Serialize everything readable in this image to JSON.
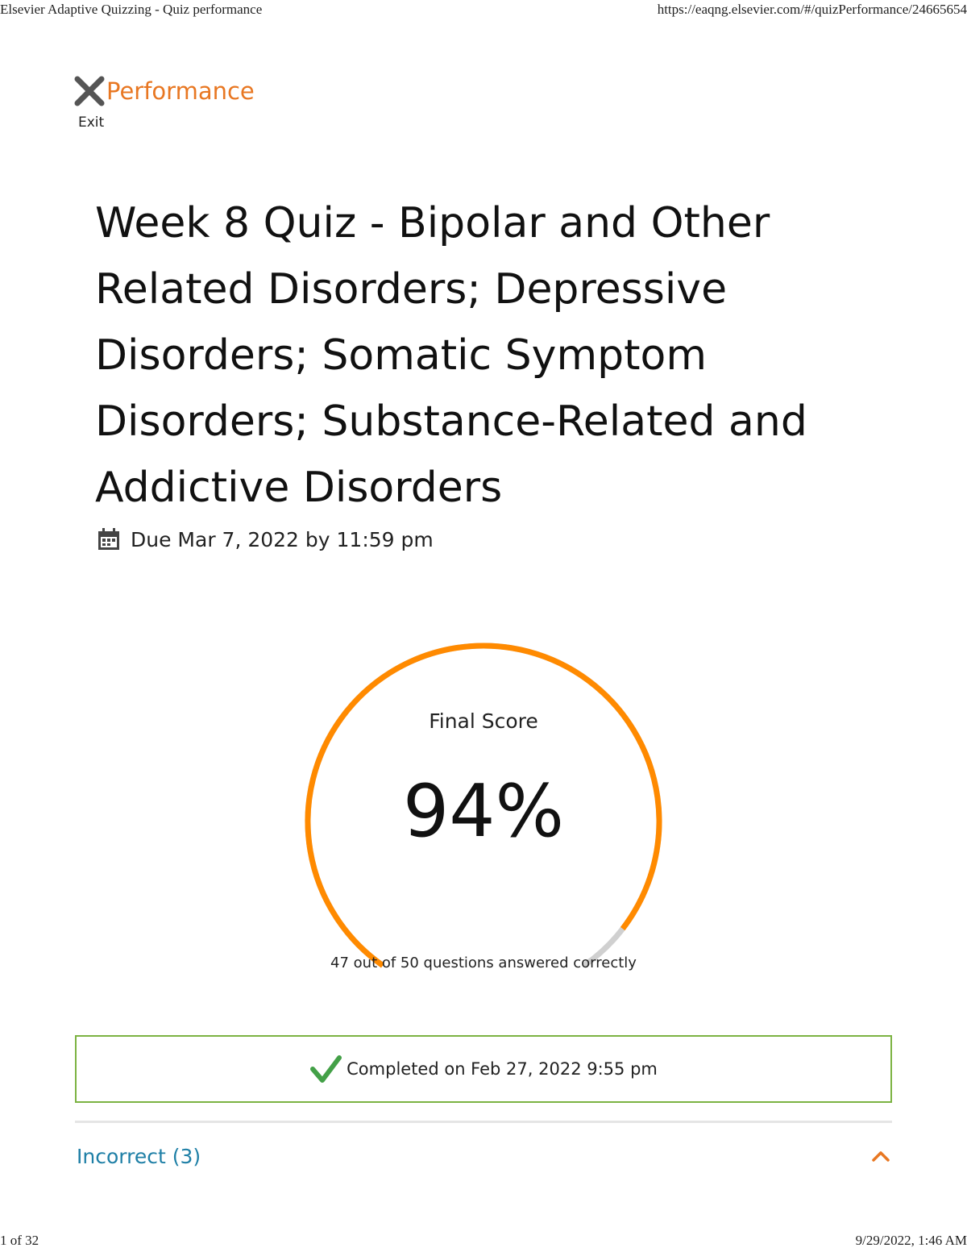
{
  "print_header": {
    "page_title": "Elsevier Adaptive Quizzing - Quiz performance",
    "url": "https://eaqng.elsevier.com/#/quizPerformance/24665654"
  },
  "print_footer": {
    "page_count": "1 of 32",
    "timestamp": "9/29/2022, 1:46 AM"
  },
  "nav": {
    "exit_label": "Exit",
    "section_title": "Performance"
  },
  "quiz": {
    "title": "Week 8 Quiz - Bipolar and Other Related Disorders; Depressive Disorders; Somatic Symptom Disorders; Substance-Related and Addictive Disorders",
    "due": "Due Mar 7, 2022 by 11:59 pm"
  },
  "score": {
    "label": "Final Score",
    "value_text": "94%",
    "fraction": 0.94,
    "summary": "47 out of 50 questions answered correctly"
  },
  "completion": {
    "text": "Completed on Feb 27, 2022 9:55 pm"
  },
  "results": {
    "incorrect_label": "Incorrect (3)"
  },
  "colors": {
    "accent_orange": "#e87722",
    "gauge_orange": "#ff8a00",
    "gauge_track": "#d0d0d0",
    "success_green": "#43a047",
    "link_blue": "#1e7fa6"
  }
}
